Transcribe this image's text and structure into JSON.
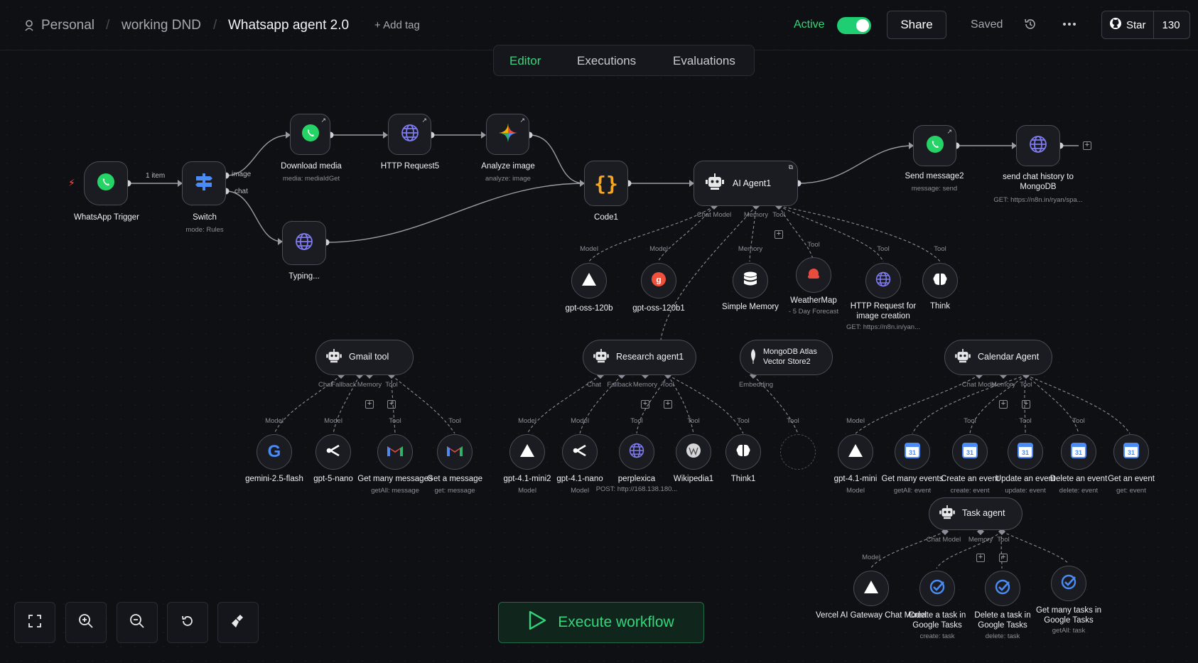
{
  "header": {
    "breadcrumb": [
      "Personal",
      "working DND"
    ],
    "workflow_name": "Whatsapp agent 2.0",
    "add_tag": "+ Add tag",
    "active_label": "Active",
    "active_on": true,
    "share_label": "Share",
    "saved_label": "Saved",
    "star_label": "Star",
    "star_count": "130"
  },
  "tabs": [
    "Editor",
    "Executions",
    "Evaluations"
  ],
  "active_tab": "Editor",
  "edge_labels": {
    "items": "1 item",
    "image": "image",
    "chat": "chat"
  },
  "nodes": {
    "whatsapp_trigger": {
      "label": "WhatsApp Trigger",
      "icon": "whatsapp-icon"
    },
    "switch": {
      "label": "Switch",
      "sub": "mode: Rules",
      "icon": "switch-icon"
    },
    "download_media": {
      "label": "Download media",
      "sub": "media: mediaIdGet",
      "icon": "whatsapp-icon"
    },
    "http5": {
      "label": "HTTP Request5",
      "icon": "globe-icon"
    },
    "analyze_image": {
      "label": "Analyze image",
      "sub": "analyze: image",
      "icon": "gemini-icon"
    },
    "typing": {
      "label": "Typing...",
      "icon": "globe-icon"
    },
    "code1": {
      "label": "Code1",
      "icon": "code-braces-icon"
    },
    "ai_agent1": {
      "label": "AI Agent1",
      "ports": [
        "Chat Model",
        "Memory",
        "Tool"
      ],
      "icon": "robot-icon"
    },
    "send_message2": {
      "label": "Send message2",
      "sub": "message: send",
      "icon": "whatsapp-icon"
    },
    "send_history": {
      "label": "send chat history to MongoDB",
      "sub": "GET: https://n8n.in/ryan/spa...",
      "icon": "globe-icon"
    },
    "gpt_oss": {
      "label": "gpt-oss-120b",
      "type": "Model"
    },
    "gpt_oss1": {
      "label": "gpt-oss-120b1",
      "type": "Model"
    },
    "simple_memory": {
      "label": "Simple Memory",
      "type": "Memory"
    },
    "weathermap": {
      "label": "WeatherMap",
      "sub": "- 5 Day Forecast",
      "type": "Tool"
    },
    "http_image": {
      "label": "HTTP Request for image creation",
      "sub": "GET: https://n8n.in/yan...",
      "type": "Tool"
    },
    "think": {
      "label": "Think",
      "type": "Tool"
    },
    "gmail_tool": {
      "label": "Gmail tool",
      "ports": [
        "Chat",
        "Fallback",
        "Memory",
        "Tool"
      ]
    },
    "research_agent": {
      "label": "Research agent1",
      "ports": [
        "Chat",
        "Fallback",
        "Memory",
        "Tool"
      ]
    },
    "mongodb_vs": {
      "label": "MongoDB Atlas Vector Store2",
      "port": "Embedding"
    },
    "calendar_agent": {
      "label": "Calendar Agent",
      "ports": [
        "Chat Model",
        "Memory",
        "Tool"
      ]
    },
    "gemini": {
      "label": "gemini-2.5-flash",
      "type": "Model"
    },
    "gpt5nano": {
      "label": "gpt-5-nano",
      "type": "Model"
    },
    "get_many_messages": {
      "label": "Get many messages",
      "sub": "getAll: message",
      "type": "Tool"
    },
    "get_a_message": {
      "label": "Get a message",
      "sub": "get: message",
      "type": "Tool"
    },
    "gpt41mini2": {
      "label": "gpt-4.1-mini2",
      "sub": "Model",
      "type": "Model"
    },
    "gpt41nano": {
      "label": "gpt-4.1-nano",
      "sub": "Model",
      "type": "Model"
    },
    "perplexica": {
      "label": "perplexica",
      "sub": "POST: http://168.138.180...",
      "type": "Tool"
    },
    "wikipedia": {
      "label": "Wikipedia1",
      "type": "Tool"
    },
    "think1": {
      "label": "Think1",
      "type": "Tool"
    },
    "gpt41mini": {
      "label": "gpt-4.1-mini",
      "sub": "Model",
      "type": "Model"
    },
    "get_many_events": {
      "label": "Get many events",
      "sub": "getAll: event",
      "type": "Tool"
    },
    "create_event": {
      "label": "Create an event",
      "sub": "create: event",
      "type": "Tool"
    },
    "update_event": {
      "label": "Update an event",
      "sub": "update: event",
      "type": "Tool"
    },
    "delete_event": {
      "label": "Delete an event",
      "sub": "delete: event",
      "type": "Tool"
    },
    "get_event": {
      "label": "Get an event",
      "sub": "get: event",
      "type": "Tool"
    },
    "task_agent": {
      "label": "Task agent",
      "ports": [
        "Chat Model",
        "Memory",
        "Tool"
      ]
    },
    "vercel": {
      "label": "Vercel AI Gateway Chat Model",
      "type": "Model"
    },
    "create_task": {
      "label": "Create a task in Google Tasks",
      "sub": "create: task"
    },
    "delete_task": {
      "label": "Delete a task in Google Tasks",
      "sub": "delete: task"
    },
    "get_tasks": {
      "label": "Get many tasks in Google Tasks",
      "sub": "getAll: task",
      "type": "Tool"
    }
  },
  "execute_label": "Execute workflow",
  "colors": {
    "accent": "#2fd87a",
    "whatsapp": "#25d366",
    "canvas": "#0f1014",
    "node": "#1b1c22"
  }
}
